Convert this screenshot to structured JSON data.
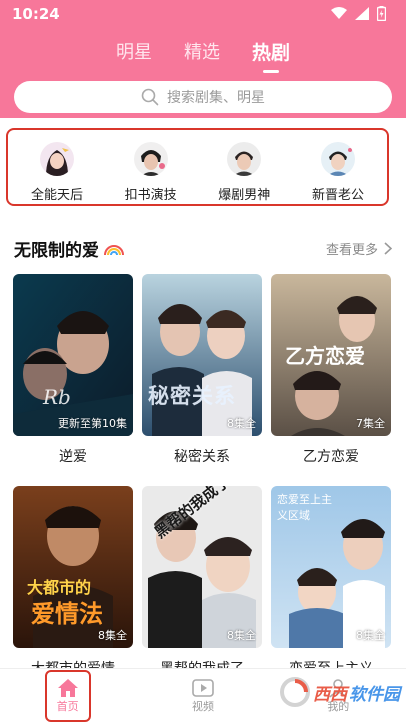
{
  "status": {
    "time": "10:24"
  },
  "tabs": [
    {
      "label": "明星"
    },
    {
      "label": "精选"
    },
    {
      "label": "热剧"
    }
  ],
  "search": {
    "placeholder": "搜索剧集、明星"
  },
  "categories": [
    {
      "label": "全能天后"
    },
    {
      "label": "扣书演技"
    },
    {
      "label": "爆剧男神"
    },
    {
      "label": "新晋老公"
    }
  ],
  "section": {
    "title": "无限制的爱",
    "more": "查看更多"
  },
  "dramas": [
    {
      "title": "逆爱",
      "badge": "更新至第10集",
      "poster_text": ""
    },
    {
      "title": "秘密关系",
      "badge": "8集全",
      "poster_text": "秘密关系"
    },
    {
      "title": "乙方恋爱",
      "badge": "7集全",
      "poster_text": "乙方恋爱"
    },
    {
      "title": "大都市的爱情",
      "badge": "8集全",
      "poster_text_1": "大都市的",
      "poster_text_2": "爱情法"
    },
    {
      "title": "黑帮的我成了",
      "badge": "8集全",
      "poster_text": "黑帮的我成了高中生"
    },
    {
      "title": "恋爱至上主义",
      "badge": "8集全",
      "poster_text": "恋爱至上主义区域"
    }
  ],
  "bottom_nav": [
    {
      "label": "首页"
    },
    {
      "label": "视频"
    },
    {
      "label": "我的"
    }
  ],
  "watermark": {
    "part1": "西西",
    "part2": "软件园"
  },
  "colors": {
    "brand_pink": "#f7779a",
    "highlight_red": "#d9362b"
  }
}
